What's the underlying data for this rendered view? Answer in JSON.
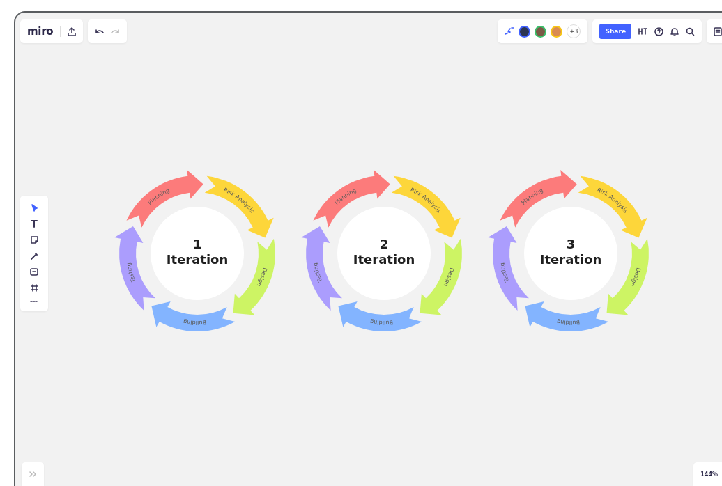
{
  "top_bar": {
    "logo": "miro",
    "collaborators_more": "+3",
    "share_button": "Share"
  },
  "diagrams": [
    {
      "number": "1",
      "title": "Iteration",
      "segments": [
        {
          "label": "Planning",
          "color": "#fc7b7b"
        },
        {
          "label": "Risk Analysis",
          "color": "#fdd63a"
        },
        {
          "label": "Design",
          "color": "#cdf464"
        },
        {
          "label": "Building",
          "color": "#83b4ff"
        },
        {
          "label": "Testing",
          "color": "#ab9dfd"
        }
      ]
    },
    {
      "number": "2",
      "title": "Iteration",
      "segments": [
        {
          "label": "Planning",
          "color": "#fc7b7b"
        },
        {
          "label": "Risk Analysis",
          "color": "#fdd63a"
        },
        {
          "label": "Design",
          "color": "#cdf464"
        },
        {
          "label": "Building",
          "color": "#83b4ff"
        },
        {
          "label": "Testing",
          "color": "#ab9dfd"
        }
      ]
    },
    {
      "number": "3",
      "title": "Iteration",
      "segments": [
        {
          "label": "Planning",
          "color": "#fc7b7b"
        },
        {
          "label": "Risk Analysis",
          "color": "#fdd63a"
        },
        {
          "label": "Design",
          "color": "#cdf464"
        },
        {
          "label": "Building",
          "color": "#83b4ff"
        },
        {
          "label": "Testing",
          "color": "#ab9dfd"
        }
      ]
    }
  ],
  "zoom_level": "144%"
}
